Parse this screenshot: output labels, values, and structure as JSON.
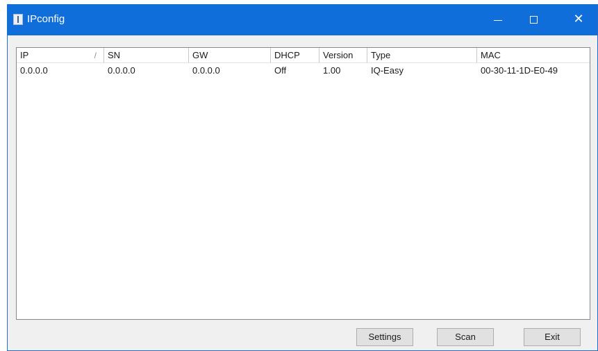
{
  "window": {
    "title": "IPconfig"
  },
  "list": {
    "columns": [
      "IP",
      "SN",
      "GW",
      "DHCP",
      "Version",
      "Type",
      "MAC"
    ],
    "sort_indicator": "/",
    "rows": [
      [
        "0.0.0.0",
        "0.0.0.0",
        "0.0.0.0",
        "Off",
        "1.00",
        "IQ-Easy",
        "00-30-11-1D-E0-49"
      ]
    ]
  },
  "buttons": {
    "settings": "Settings",
    "scan": "Scan",
    "exit": "Exit"
  },
  "icons": {
    "app": "app-icon",
    "minimize": "minimize-icon",
    "maximize": "maximize-icon",
    "close": "close-icon"
  },
  "colors": {
    "titlebar": "#0f6ed9",
    "window_bg": "#f0f0f0"
  }
}
